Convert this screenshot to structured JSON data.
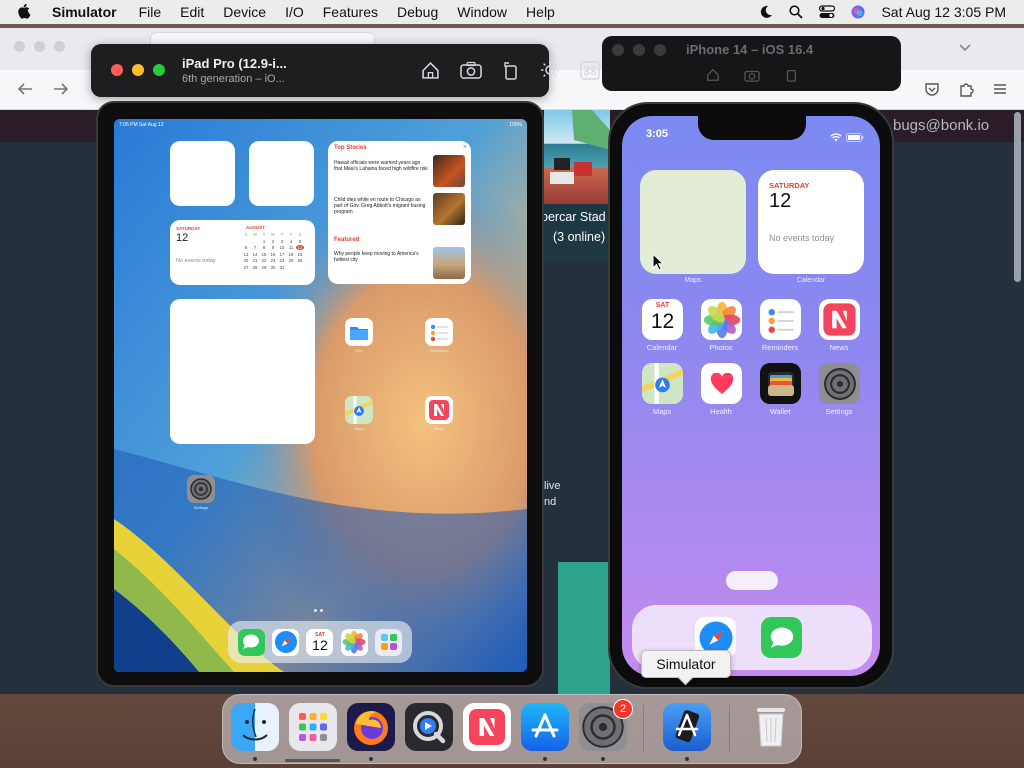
{
  "menubar": {
    "app_name": "Simulator",
    "items": [
      "File",
      "Edit",
      "Device",
      "I/O",
      "Features",
      "Debug",
      "Window",
      "Help"
    ],
    "clock": "Sat Aug 12  3:05 PM",
    "status_icons": [
      "dark-mode-moon-icon",
      "spotlight-search-icon",
      "control-center-icon",
      "siri-icon"
    ]
  },
  "browser": {
    "contact": "bugs@bonk.io",
    "game_title": "percar Stad",
    "game_online": "(3 online)",
    "live_line1": "live",
    "live_line2": "nd"
  },
  "ipad_window": {
    "title": "iPad Pro (12.9-i...",
    "subtitle": "6th generation – iO...",
    "toolbar_icons": [
      "home-icon",
      "screenshot-camera-icon",
      "rotate-icon",
      "appearance-brightness-icon",
      "command-icon"
    ],
    "status_time": "7:05 PM  Sat Aug 12",
    "status_right": "100%",
    "calendar_widget": {
      "day": "SATURDAY",
      "date": "12",
      "month": "AUGUST",
      "no_events": "No events today",
      "weekdays": [
        "S",
        "M",
        "T",
        "W",
        "T",
        "F",
        "S"
      ],
      "days": [
        "",
        "",
        "1",
        "2",
        "3",
        "4",
        "5",
        "6",
        "7",
        "8",
        "9",
        "10",
        "11",
        "12",
        "13",
        "14",
        "15",
        "16",
        "17",
        "18",
        "19",
        "20",
        "21",
        "22",
        "23",
        "24",
        "25",
        "26",
        "27",
        "28",
        "29",
        "30",
        "31",
        "",
        ""
      ]
    },
    "news_widget": {
      "heading": "Top Stories",
      "stories": [
        "Hawaii officials were warned years ago that Maui's Lahaina faced high wildfire risk",
        "Child dies while en route to Chicago as part of Gov. Greg Abbott's migrant busing program"
      ],
      "featured_heading": "Featured",
      "featured_story": "Why people keep moving to America's hottest city"
    },
    "apps": [
      "Files",
      "Reminders",
      "Maps",
      "News",
      "Settings"
    ],
    "dock_calendar_day": "SAT",
    "dock_calendar_date": "12"
  },
  "iphone_window": {
    "title": "iPhone 14 – iOS 16.4",
    "toolbar_icons": [
      "home-icon",
      "screenshot-camera-icon",
      "rotate-icon"
    ],
    "status_time": "3:05",
    "widgets": {
      "maps_label": "Maps",
      "calendar_label": "Calendar",
      "calendar_day": "SATURDAY",
      "calendar_date": "12",
      "calendar_no_events": "No events today"
    },
    "calendar_icon_day": "SAT",
    "calendar_icon_date": "12",
    "apps_row1": [
      "Calendar",
      "Photos",
      "Reminders",
      "News"
    ],
    "apps_row2": [
      "Maps",
      "Health",
      "Wallet",
      "Settings"
    ],
    "dock_apps": [
      "safari-icon",
      "messages-icon"
    ]
  },
  "tooltip": "Simulator",
  "dock": {
    "items": [
      "Finder",
      "Launchpad",
      "Firefox",
      "QuickTime Player",
      "News",
      "App Store",
      "System Settings",
      "Simulator",
      "Trash"
    ],
    "settings_badge": "2"
  }
}
